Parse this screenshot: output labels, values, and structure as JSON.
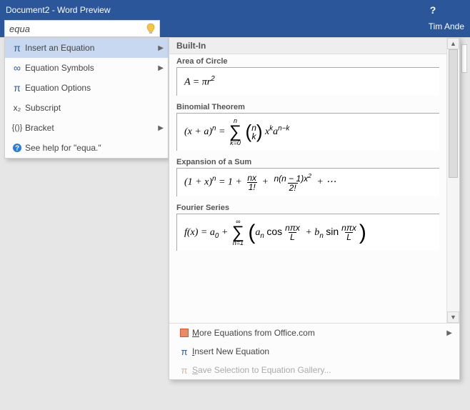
{
  "window": {
    "title": "Document2 - Word Preview"
  },
  "user": {
    "name": "Tim Ande"
  },
  "search": {
    "value": "equa"
  },
  "suggestions": [
    {
      "icon": "π",
      "label": "Insert an Equation",
      "arrow": true,
      "hl": true
    },
    {
      "icon": "∞",
      "label": "Equation Symbols",
      "arrow": true,
      "hl": false
    },
    {
      "icon": "π",
      "label": "Equation Options",
      "arrow": false,
      "hl": false
    },
    {
      "icon": "x₂",
      "label": "Subscript",
      "arrow": false,
      "hl": false
    },
    {
      "icon": "{()}",
      "label": "Bracket",
      "arrow": true,
      "hl": false
    },
    {
      "icon": "?",
      "label": "See help for \"equa.\"",
      "arrow": false,
      "hl": false
    }
  ],
  "gallery": {
    "header": "Built-In",
    "items": [
      {
        "title": "Area of Circle"
      },
      {
        "title": "Binomial Theorem"
      },
      {
        "title": "Expansion of a Sum"
      },
      {
        "title": "Fourier Series"
      }
    ],
    "footer": {
      "more": "More Equations from Office.com",
      "insert": "Insert New Equation",
      "save": "Save Selection to Equation Gallery..."
    }
  }
}
